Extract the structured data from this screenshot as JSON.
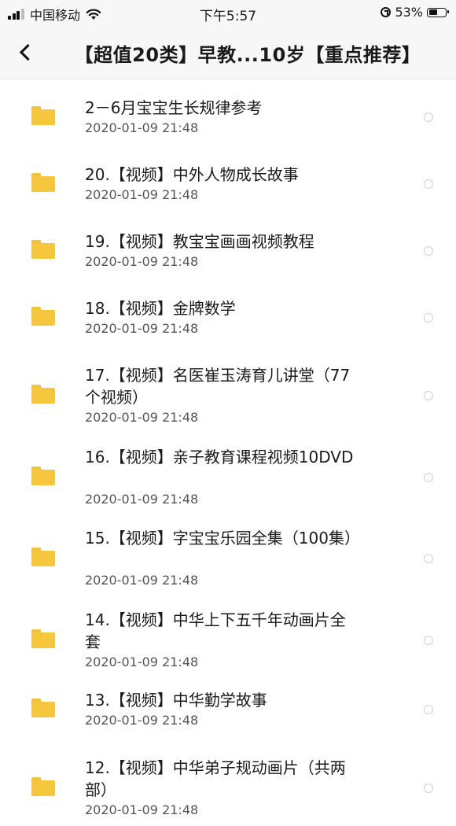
{
  "status_bar": {
    "carrier": "中国移动",
    "time": "下午5:57",
    "battery_percent": "53%",
    "battery_level": 0.53,
    "signal_icon": "cellular-signal-icon",
    "wifi_icon": "wifi-icon",
    "lock_icon": "rotation-lock-icon"
  },
  "nav": {
    "back_icon": "chevron-left-icon",
    "title": "【超值20类】早教...10岁【重点推荐】"
  },
  "colors": {
    "folder": "#f6c73d",
    "bar_background": "#f7f7f7",
    "date_text": "#555555"
  },
  "files": [
    {
      "name": "2－6月宝宝生长规律参考",
      "date": "2020-01-09 21:48"
    },
    {
      "name": "20.【视频】中外人物成长故事",
      "date": "2020-01-09 21:48"
    },
    {
      "name": "19.【视频】教宝宝画画视频教程",
      "date": "2020-01-09 21:48"
    },
    {
      "name": "18.【视频】金牌数学",
      "date": "2020-01-09 21:48"
    },
    {
      "name": "17.【视频】名医崔玉涛育儿讲堂（77个视频）",
      "date": "2020-01-09 21:48"
    },
    {
      "name": "16.【视频】亲子教育课程视频10DVD",
      "date": "2020-01-09 21:48"
    },
    {
      "name": "15.【视频】字宝宝乐园全集（100集）",
      "date": "2020-01-09 21:48"
    },
    {
      "name": "14.【视频】中华上下五千年动画片全套",
      "date": "2020-01-09 21:48"
    },
    {
      "name": "13.【视频】中华勤学故事",
      "date": "2020-01-09 21:48"
    },
    {
      "name": "12.【视频】中华弟子规动画片（共两部）",
      "date": "2020-01-09 21:48"
    }
  ]
}
